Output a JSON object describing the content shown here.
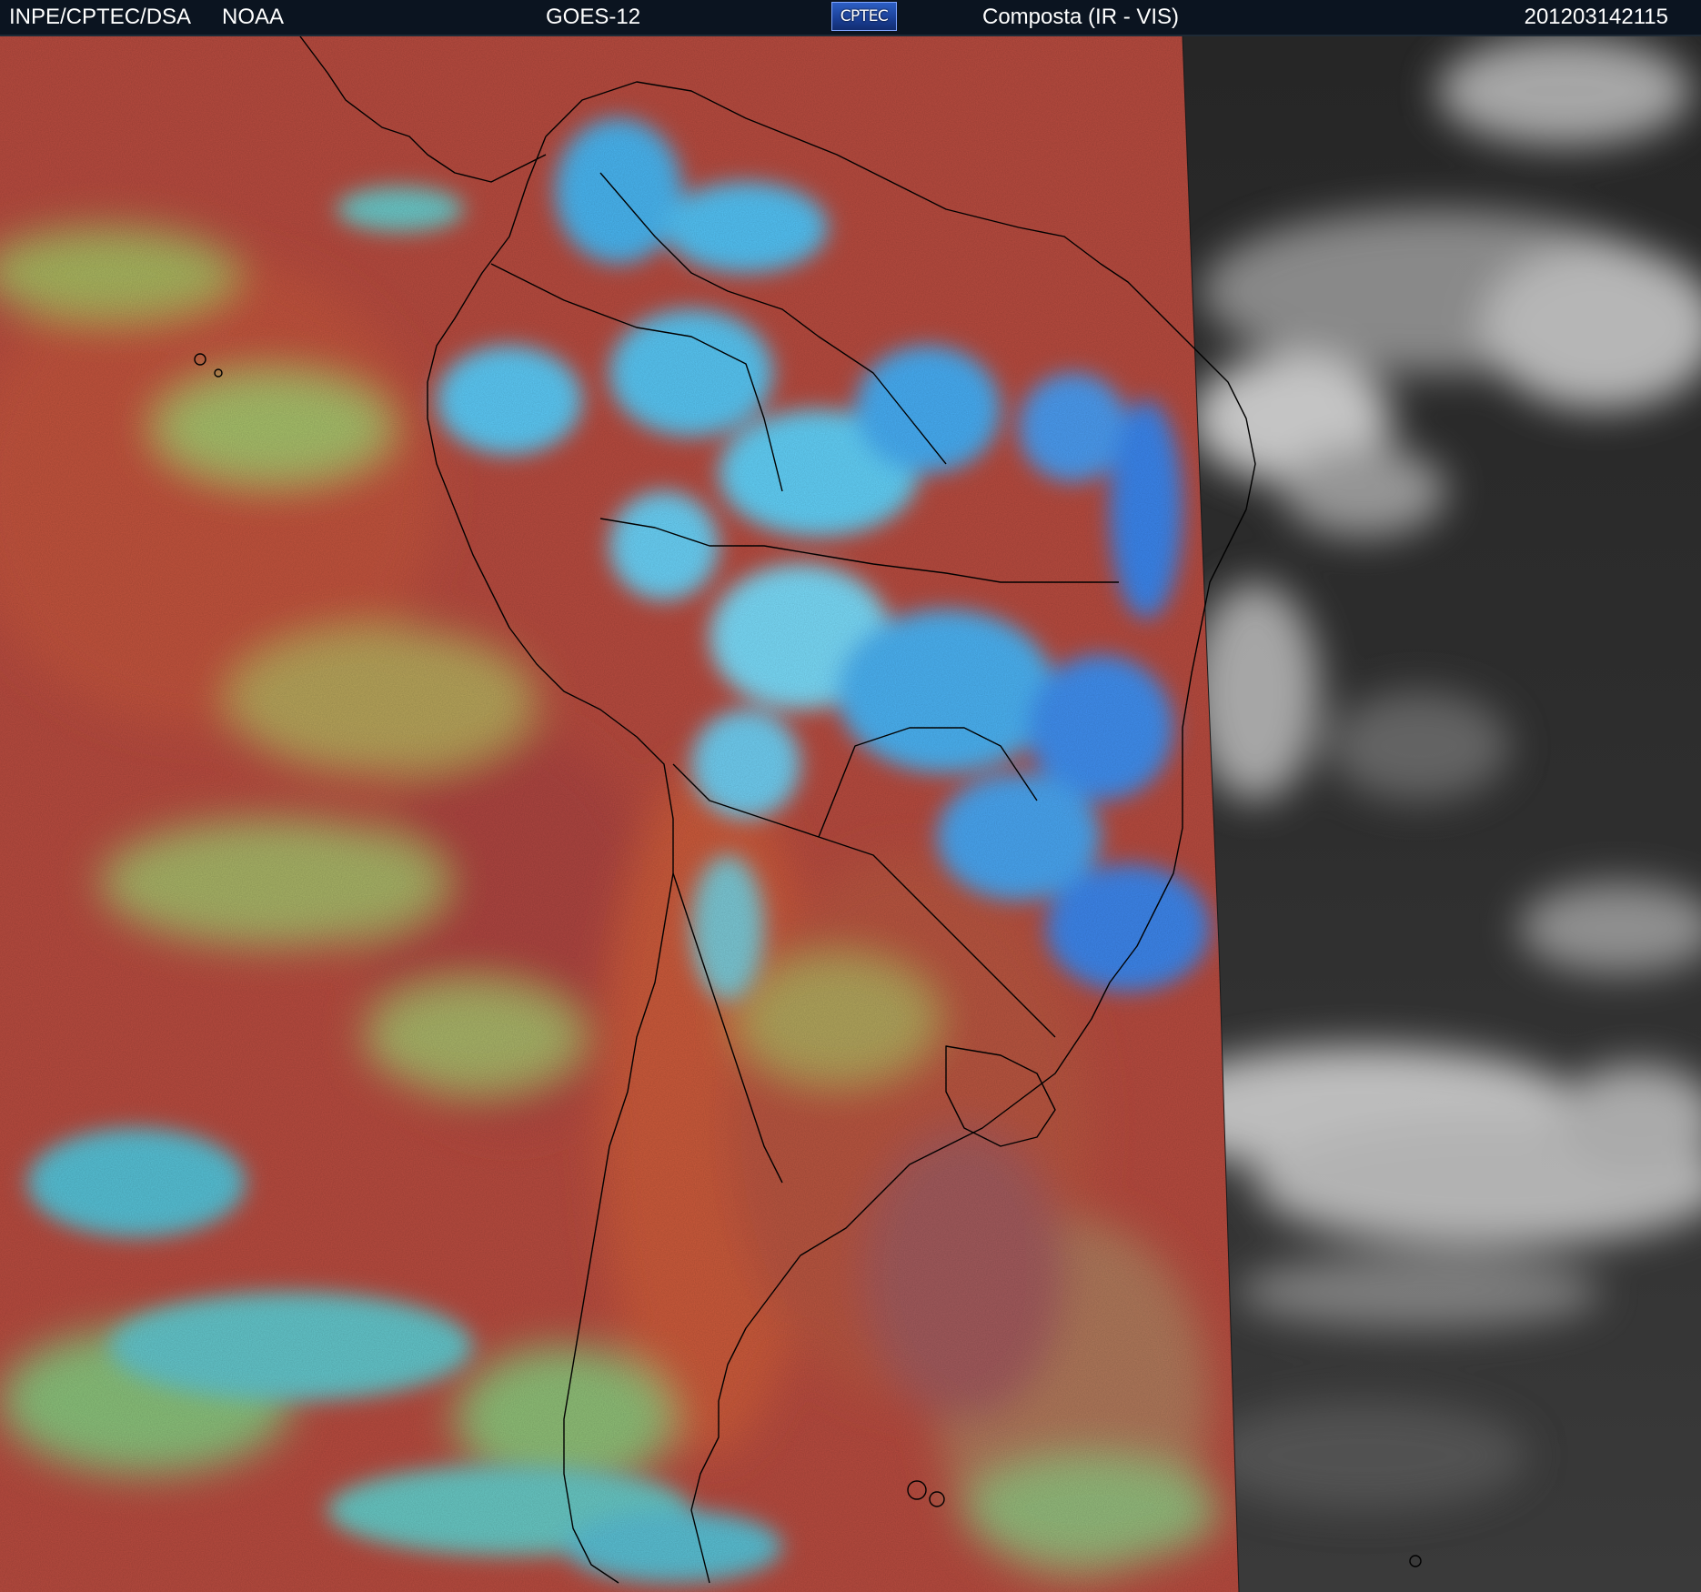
{
  "header": {
    "agency": "INPE/CPTEC/DSA",
    "organization": "NOAA",
    "satellite": "GOES-12",
    "logo_text": "CPTEC",
    "product": "Composta (IR - VIS)",
    "timestamp": "201203142115"
  },
  "imagery": {
    "type": "satellite-composite",
    "channels": [
      "IR",
      "VIS"
    ],
    "colors": {
      "ir_warm_surface": "#b94a3c",
      "ir_cold_cloud": "#3fb7f0",
      "ir_mid_cloud": "#9ec56a",
      "vis_background": "#2b2b2b",
      "vis_cloud": "#d8d8d8",
      "coastline": "#000000"
    }
  }
}
